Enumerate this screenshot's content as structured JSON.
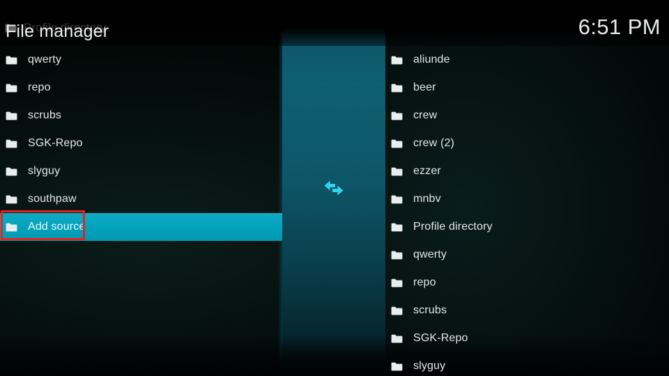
{
  "window": {
    "app": "Kodi",
    "screen_name": "file-manager"
  },
  "header": {
    "title": "File manager",
    "ghost_title": "Profile directory",
    "clock": "6:51 PM",
    "folder_icon": "folder-icon"
  },
  "center": {
    "swap_icon": "swap-horizontal-arrows-icon"
  },
  "colors": {
    "highlight": "#03a3bd",
    "annotation": "#e8221f",
    "panel_teal": "#0e5f72",
    "background": "#061311",
    "text": "#e4e8e8"
  },
  "annotation": {
    "target": "Add source",
    "shape": "rectangle"
  },
  "left_pane": {
    "name": "file-list-left",
    "items": [
      {
        "label": "qwerty",
        "icon": "folder-icon",
        "selected": false
      },
      {
        "label": "repo",
        "icon": "folder-icon",
        "selected": false
      },
      {
        "label": "scrubs",
        "icon": "folder-icon",
        "selected": false
      },
      {
        "label": "SGK-Repo",
        "icon": "folder-icon",
        "selected": false
      },
      {
        "label": "slyguy",
        "icon": "folder-icon",
        "selected": false
      },
      {
        "label": "southpaw",
        "icon": "folder-icon",
        "selected": false
      },
      {
        "label": "Add source",
        "icon": "folder-icon",
        "selected": true
      }
    ]
  },
  "right_pane": {
    "name": "file-list-right",
    "items": [
      {
        "label": "aliunde",
        "icon": "folder-icon",
        "selected": false
      },
      {
        "label": "beer",
        "icon": "folder-icon",
        "selected": false
      },
      {
        "label": "crew",
        "icon": "folder-icon",
        "selected": false
      },
      {
        "label": "crew (2)",
        "icon": "folder-icon",
        "selected": false
      },
      {
        "label": "ezzer",
        "icon": "folder-icon",
        "selected": false
      },
      {
        "label": "mnbv",
        "icon": "folder-icon",
        "selected": false
      },
      {
        "label": "Profile directory",
        "icon": "folder-icon",
        "selected": false
      },
      {
        "label": "qwerty",
        "icon": "folder-icon",
        "selected": false
      },
      {
        "label": "repo",
        "icon": "folder-icon",
        "selected": false
      },
      {
        "label": "scrubs",
        "icon": "folder-icon",
        "selected": false
      },
      {
        "label": "SGK-Repo",
        "icon": "folder-icon",
        "selected": false
      },
      {
        "label": "slyguy",
        "icon": "folder-icon",
        "selected": false
      }
    ]
  }
}
